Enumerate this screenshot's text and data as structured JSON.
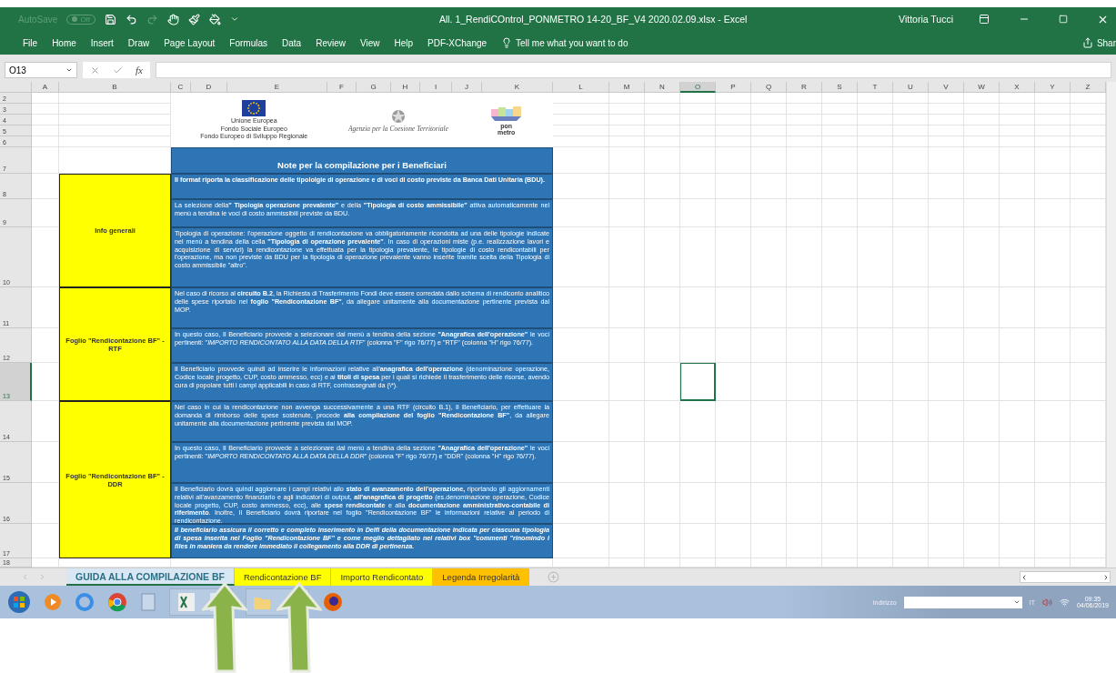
{
  "window": {
    "autosave": {
      "label": "AutoSave",
      "toggle": "Off",
      "on": false
    },
    "title": "All. 1_RendiCOntrol_PONMETRO 14-20_BF_V4 2020.02.09.xlsx  -  Excel",
    "user": "Vittoria Tucci"
  },
  "ribbon": {
    "tabs": [
      "File",
      "Home",
      "Insert",
      "Draw",
      "Page Layout",
      "Formulas",
      "Data",
      "Review",
      "View",
      "Help",
      "PDF-XChange"
    ],
    "tell_me": "Tell me what you want to do",
    "share": "Shar"
  },
  "formula_bar": {
    "name_box": "O13",
    "fx": "fx"
  },
  "columns": [
    {
      "label": "A",
      "selected": false
    },
    {
      "label": "B",
      "selected": false
    },
    {
      "label": "C",
      "selected": false
    },
    {
      "label": "D",
      "selected": false
    },
    {
      "label": "E",
      "selected": false
    },
    {
      "label": "F",
      "selected": false
    },
    {
      "label": "G",
      "selected": false
    },
    {
      "label": "H",
      "selected": false
    },
    {
      "label": "I",
      "selected": false
    },
    {
      "label": "J",
      "selected": false
    },
    {
      "label": "K",
      "selected": false
    },
    {
      "label": "L",
      "selected": false
    },
    {
      "label": "M",
      "selected": false
    },
    {
      "label": "N",
      "selected": false
    },
    {
      "label": "O",
      "selected": true
    },
    {
      "label": "P",
      "selected": false
    },
    {
      "label": "Q",
      "selected": false
    },
    {
      "label": "R",
      "selected": false
    },
    {
      "label": "S",
      "selected": false
    },
    {
      "label": "T",
      "selected": false
    },
    {
      "label": "U",
      "selected": false
    },
    {
      "label": "V",
      "selected": false
    },
    {
      "label": "W",
      "selected": false
    },
    {
      "label": "X",
      "selected": false
    },
    {
      "label": "Y",
      "selected": false
    },
    {
      "label": "Z",
      "selected": false
    }
  ],
  "rows": [
    {
      "label": "2",
      "selected": false
    },
    {
      "label": "3",
      "selected": false
    },
    {
      "label": "4",
      "selected": false
    },
    {
      "label": "5",
      "selected": false
    },
    {
      "label": "6",
      "selected": false
    },
    {
      "label": "7",
      "selected": false
    },
    {
      "label": "8",
      "selected": false
    },
    {
      "label": "9",
      "selected": false
    },
    {
      "label": "10",
      "selected": false
    },
    {
      "label": "11",
      "selected": false
    },
    {
      "label": "12",
      "selected": false
    },
    {
      "label": "13",
      "selected": true
    },
    {
      "label": "14",
      "selected": false
    },
    {
      "label": "15",
      "selected": false
    },
    {
      "label": "16",
      "selected": false
    },
    {
      "label": "17",
      "selected": false
    },
    {
      "label": "18",
      "selected": false
    }
  ],
  "logos": {
    "eu": [
      "Unione Europea",
      "Fondo Sociale Europeo",
      "Fondo Europeo di Sviluppo Regionale"
    ],
    "agency": "Agenzia per la Coesione Territoriale",
    "pon": "pon metro"
  },
  "sheet": {
    "header": "Note per la compilazione per i Beneficiari",
    "sections": [
      {
        "label": "Info generali",
        "notes": [
          {
            "kind": "bold",
            "text": "Il format riporta la classificazione delle tipololgie di operazione e di voci di costo previste da Banca Dati Unitaria (BDU)."
          },
          {
            "kind": "plain",
            "text": "La selezione della**\" Tipologia operazione prevalente\"** e della **\"Tipologia di costo ammissibile\"** attiva automaticamente nel menù a tendina le voci di costo ammissibili previste da BDU."
          },
          {
            "kind": "plain",
            "text": "Tipologia di operazione: l'operazione oggetto di rendicontazione va obbligatoriamente ricondotta ad una delle tipologie indicate nel menù a tendina della cella **\"Tipologia di operazione prevalente\"**. In caso di operazioni miste (p.e. realizzazione lavori e acquisizione di servizi) la rendicontazione va effettuata per la tipologia prevalente,  le tipologie di costo rendicontabili per l'operazione, ma non previste da BDU per la tipologia di operazione prevalente vanno inserite tramite scelta della Tipologia di costo ammissibile \"altro\"."
          }
        ]
      },
      {
        "label": "Foglio \"Rendicontazione BF\" - RTF",
        "notes": [
          {
            "kind": "plain",
            "text": "Nel caso di ricorso al **circuito B.2**, la Richiesta di Trasferimento Fondi deve essere corredata dallo schema di rendiconto analitico delle spese riportato nel **foglio \"Rendicontazione BF\"**, da allegare unitamente alla documentazione pertinente prevista dal MOP."
          },
          {
            "kind": "plain",
            "text": "In questo caso, Il Beneficiario provvede a selezionare dal menù a tendina  della sezione **\"Anagrafica dell'operazione\"** le voci pertinenti: \"*IMPORTO RENDICONTATO ALLA DATA DELLA RTF*\" (colonna \"F\" rigo 76/77) e \"RTF\" (colonna \"H\" rigo 76/77)."
          },
          {
            "kind": "plain",
            "text": "Il Beneficiario provvede quindi ad inserire le informazioni relative all'**anagrafica dell'operazione** (denominazione operazione, Codice locale progetto,  CUP, costo ammesso, ecc) e ai **titoli di spesa** per i quali si richiede il trasferimento delle risorse, avendo cura di popolare tutti i campi applicabili in caso di RTF, contrassegnati da (\\*)."
          }
        ]
      },
      {
        "label": "Foglio \"Rendicontazione BF\" - DDR",
        "notes": [
          {
            "kind": "plain",
            "text": "Nel caso in cui la rendicontazione non avvenga successivamente a una RTF (circuito B.1), Il Beneficiario, per effettuare la domanda di rimborso delle spese sostenute, procede **alla compilazione del foglio \"Rendicontazione BF\"**, da allegare unitamente alla documentazione pertinente prevista dal MOP."
          },
          {
            "kind": "plain",
            "text": "In questo caso, Il Beneficiario provvede a selezionare dal menù a tendina  della sezione **\"Anagrafica dell'operazione\"** le voci pertinenti: \"*IMPORTO RENDICONTATO ALLA DATA DELLA DDR*\" (colonna \"F\" rigo 76/77) e \"DDR\" (colonna \"H\" rigo 76/77)."
          },
          {
            "kind": "plain",
            "text": "Il Beneficiario  dovrà quindi aggiornare i campi relativi allo **stato di avanzamento dell'operazione,** riportando gli aggiornamenti relativi all'avanzamento finanziario e agli indicatori di output, **all'anagrafica di progetto** (es.denominazione operazione, Codice locale progetto, CUP, costo ammesso, ecc), alle **spese rendicontate** e alla **documentazione amministrativo-contabile di riferimento**. Inoltre, Il Beneficiario dovrà riportare nel foglio \"Rendicontazione BF\" le informazioni relative al periodo di rendicontazione."
          },
          {
            "kind": "italic",
            "text": "Il beneficiario assicura il corretto e completo inserimento in Delfi della documentazione indicata  per ciascuna tipologia di spesa inserita nel Foglio \"Rendicontazione BF\" e come meglio dettagliato nei relativi box \"commenti \"rinomindo i files in maniera da rendere immediato il collegamento alla DDR di pertinenza."
          }
        ]
      }
    ]
  },
  "sheet_tabs": [
    {
      "label": "GUIDA ALLA COMPILAZIONE BF",
      "selected": true,
      "color": "#d9e7f5"
    },
    {
      "label": "Rendicontazione BF",
      "selected": false,
      "color": "#ffff00"
    },
    {
      "label": "Importo Rendicontato",
      "selected": false,
      "color": "#ffff00"
    },
    {
      "label": "Legenda Irregolarità",
      "selected": false,
      "color": "#ffc000"
    }
  ],
  "taskbar": {
    "address_label": "Indirizzo",
    "language": "IT",
    "time": "09:35",
    "date": "04/06/2019"
  }
}
